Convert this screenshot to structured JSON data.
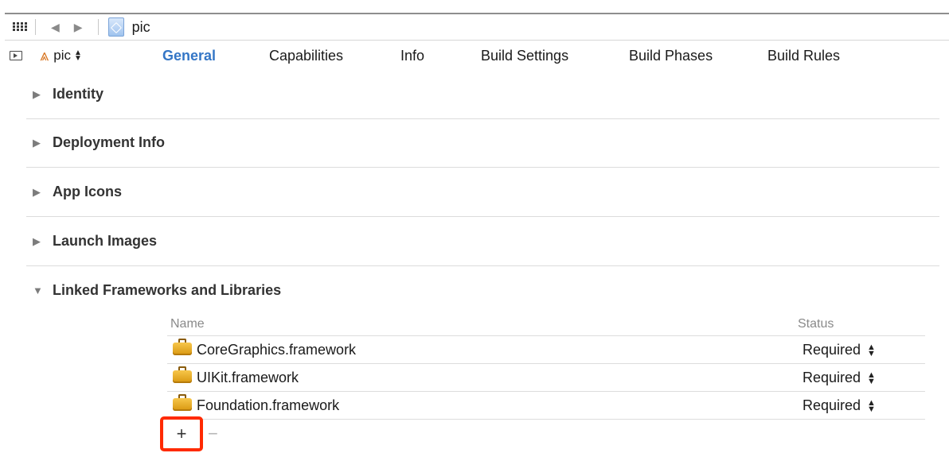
{
  "jumpbar": {
    "title": "pic"
  },
  "tabbar": {
    "target": "pic",
    "tabs": [
      {
        "label": "General",
        "active": true
      },
      {
        "label": "Capabilities",
        "active": false
      },
      {
        "label": "Info",
        "active": false
      },
      {
        "label": "Build Settings",
        "active": false
      },
      {
        "label": "Build Phases",
        "active": false
      },
      {
        "label": "Build Rules",
        "active": false
      }
    ]
  },
  "sections": [
    {
      "title": "Identity",
      "expanded": false
    },
    {
      "title": "Deployment Info",
      "expanded": false
    },
    {
      "title": "App Icons",
      "expanded": false
    },
    {
      "title": "Launch Images",
      "expanded": false
    },
    {
      "title": "Linked Frameworks and Libraries",
      "expanded": true
    }
  ],
  "frameworks": {
    "columns": {
      "name": "Name",
      "status": "Status"
    },
    "rows": [
      {
        "name": "CoreGraphics.framework",
        "status": "Required"
      },
      {
        "name": "UIKit.framework",
        "status": "Required"
      },
      {
        "name": "Foundation.framework",
        "status": "Required"
      }
    ],
    "add_label": "+",
    "remove_label": "−"
  },
  "colors": {
    "active_tab": "#3476c6",
    "highlight": "#ff2a00"
  }
}
